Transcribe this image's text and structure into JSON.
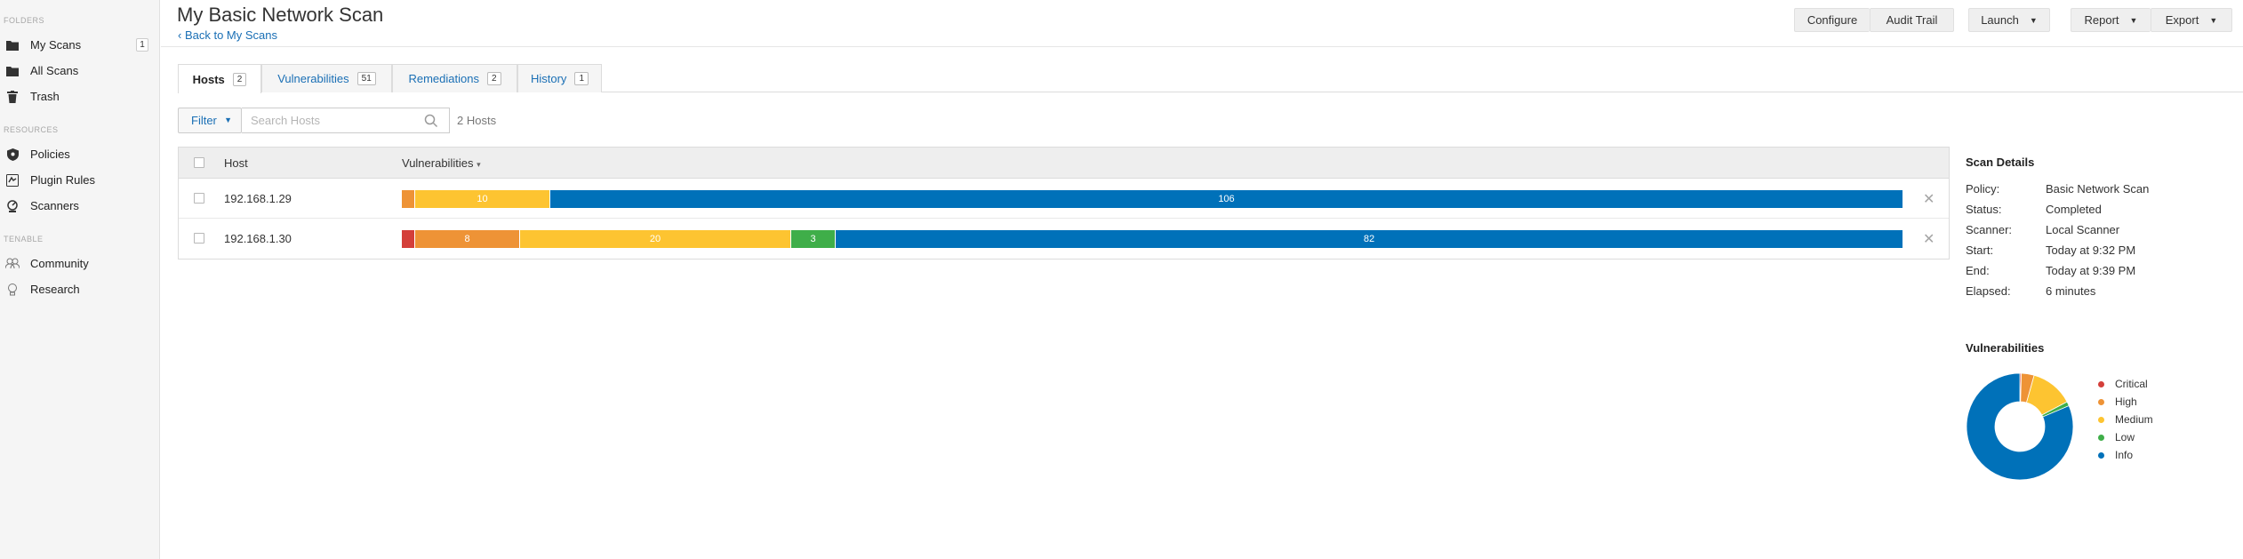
{
  "sidebar": {
    "sections": [
      {
        "label": "FOLDERS",
        "items": [
          {
            "label": "My Scans",
            "icon": "folder-icon",
            "count": "1"
          },
          {
            "label": "All Scans",
            "icon": "folder-icon"
          },
          {
            "label": "Trash",
            "icon": "trash-icon"
          }
        ]
      },
      {
        "label": "RESOURCES",
        "items": [
          {
            "label": "Policies",
            "icon": "shield-icon"
          },
          {
            "label": "Plugin Rules",
            "icon": "plugin-icon"
          },
          {
            "label": "Scanners",
            "icon": "scanner-icon"
          }
        ]
      },
      {
        "label": "TENABLE",
        "items": [
          {
            "label": "Community",
            "icon": "community-icon"
          },
          {
            "label": "Research",
            "icon": "lightbulb-icon"
          }
        ]
      }
    ]
  },
  "header": {
    "title": "My Basic Network Scan",
    "back_link": "Back to My Scans",
    "buttons": {
      "configure": "Configure",
      "audit_trail": "Audit Trail",
      "launch": "Launch",
      "report": "Report",
      "export": "Export"
    }
  },
  "tabs": [
    {
      "label": "Hosts",
      "count": "2",
      "active": true
    },
    {
      "label": "Vulnerabilities",
      "count": "51",
      "active": false
    },
    {
      "label": "Remediations",
      "count": "2",
      "active": false
    },
    {
      "label": "History",
      "count": "1",
      "active": false
    }
  ],
  "filter": {
    "button_label": "Filter",
    "search_placeholder": "Search Hosts",
    "hosts_count": "2 Hosts"
  },
  "table": {
    "columns": [
      "Host",
      "Vulnerabilities"
    ],
    "sort_indicator": "▾",
    "rows": [
      {
        "host": "192.168.1.29",
        "critical": 0,
        "high": 1,
        "medium": 10,
        "low": 0,
        "info": 106,
        "labels": {
          "high": "",
          "medium": "10",
          "info": "106"
        }
      },
      {
        "host": "192.168.1.30",
        "critical": 1,
        "high": 8,
        "medium": 20,
        "low": 3,
        "info": 82,
        "labels": {
          "critical": "",
          "high": "8",
          "medium": "20",
          "low": "3",
          "info": "82"
        }
      }
    ]
  },
  "scan_details": {
    "title": "Scan Details",
    "fields": [
      {
        "key": "Policy:",
        "value": "Basic Network Scan"
      },
      {
        "key": "Status:",
        "value": "Completed"
      },
      {
        "key": "Scanner:",
        "value": "Local Scanner"
      },
      {
        "key": "Start:",
        "value": "Today at 9:32 PM"
      },
      {
        "key": "End:",
        "value": "Today at 9:39 PM"
      },
      {
        "key": "Elapsed:",
        "value": "6 minutes"
      }
    ]
  },
  "vulnerabilities_chart": {
    "title": "Vulnerabilities",
    "legend": [
      {
        "label": "Critical",
        "color": "#d43f3a"
      },
      {
        "label": "High",
        "color": "#ee9336"
      },
      {
        "label": "Medium",
        "color": "#fdc431"
      },
      {
        "label": "Low",
        "color": "#3fae49"
      },
      {
        "label": "Info",
        "color": "#0071b9"
      }
    ],
    "values": [
      1,
      9,
      30,
      3,
      188
    ]
  },
  "colors": {
    "critical": "#d43f3a",
    "high": "#ee9336",
    "medium": "#fdc431",
    "low": "#3fae49",
    "info": "#0071b9",
    "link": "#1a6fb5"
  }
}
